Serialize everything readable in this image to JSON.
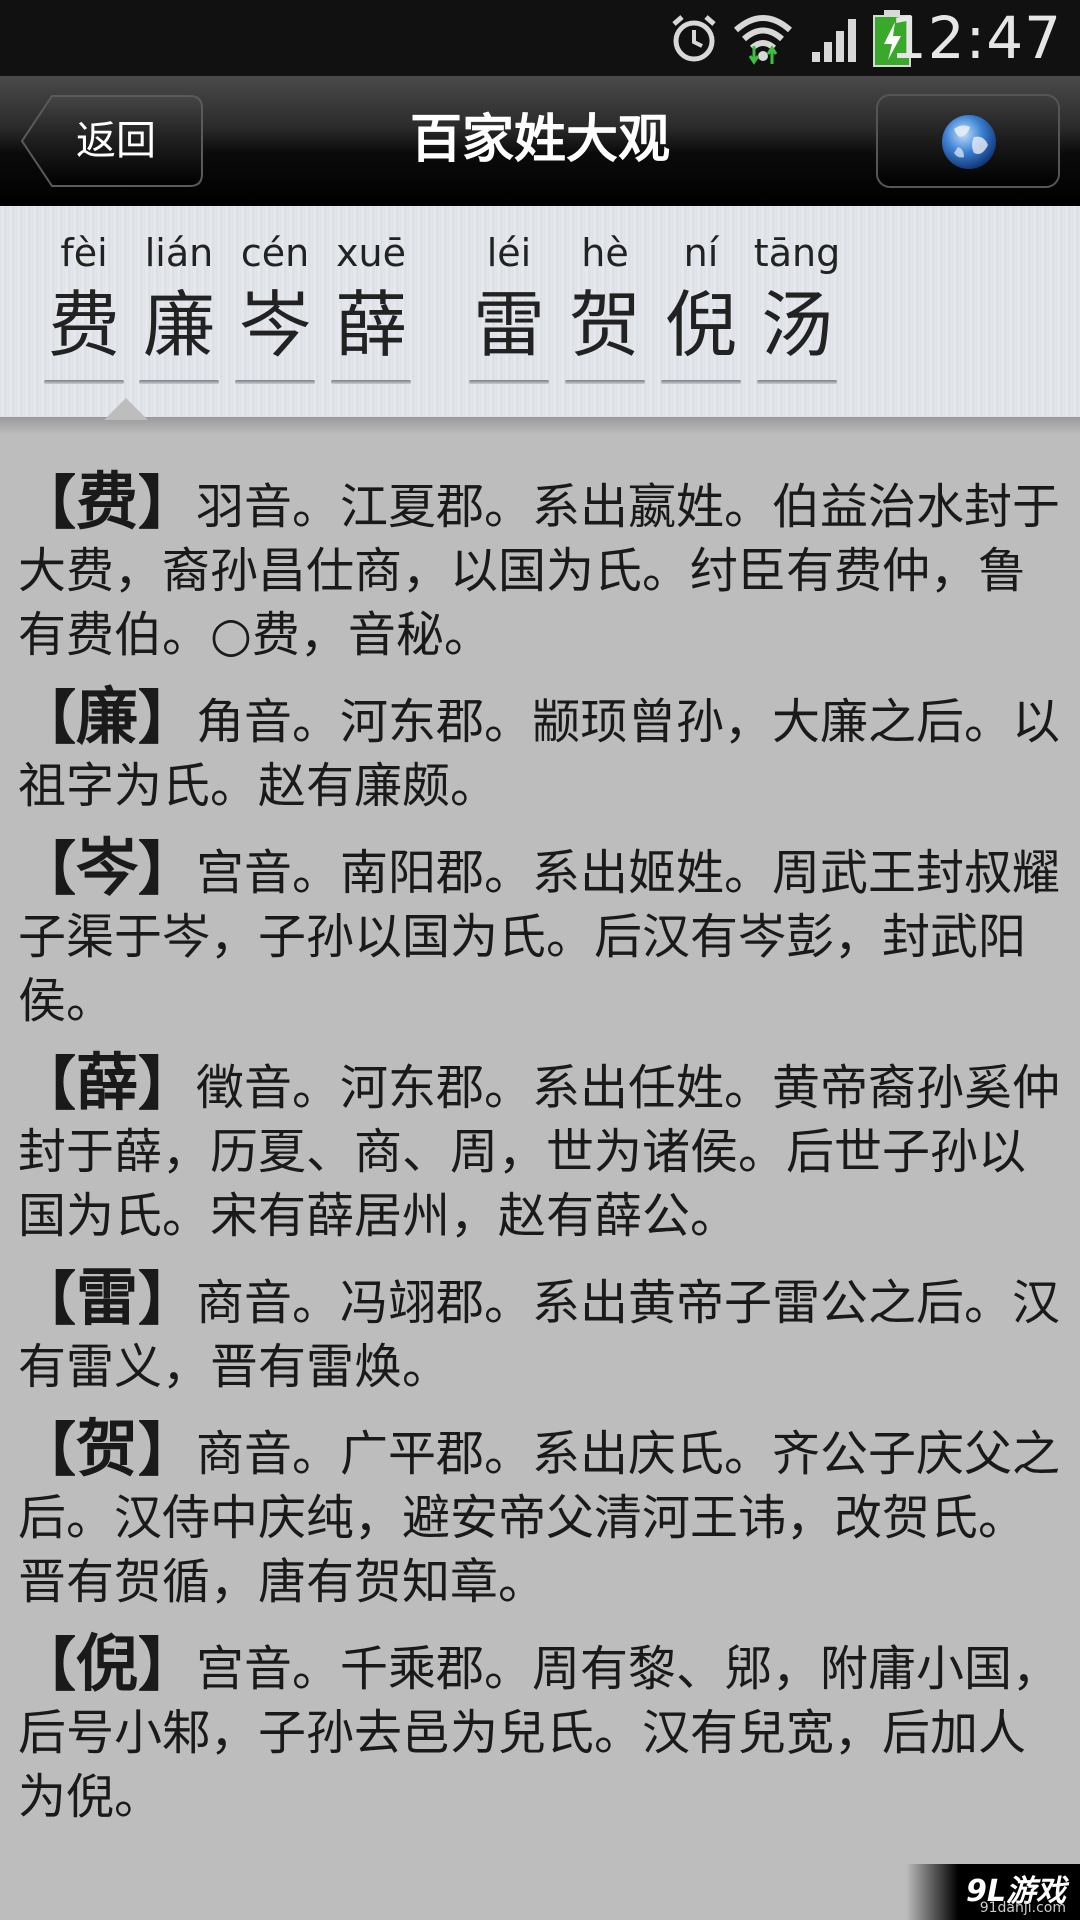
{
  "status_bar": {
    "time": "12:47",
    "icons": [
      "alarm-icon",
      "wifi-icon",
      "signal-icon",
      "battery-charging-icon"
    ]
  },
  "title_bar": {
    "back_label": "返回",
    "title": "百家姓大观",
    "globe_icon": "globe-icon"
  },
  "header": {
    "chars": [
      {
        "pinyin": "fèi",
        "char": "费"
      },
      {
        "pinyin": "lián",
        "char": "廉"
      },
      {
        "pinyin": "cén",
        "char": "岑"
      },
      {
        "pinyin": "xuē",
        "char": "薛"
      },
      {
        "pinyin": "léi",
        "char": "雷"
      },
      {
        "pinyin": "hè",
        "char": "贺"
      },
      {
        "pinyin": "ní",
        "char": "倪"
      },
      {
        "pinyin": "tāng",
        "char": "汤"
      }
    ]
  },
  "entries": [
    {
      "open": "【",
      "char": "费",
      "close": "】",
      "text": "羽音。江夏郡。系出嬴姓。伯益治水封于大费，裔孙昌仕商，以国为氏。纣臣有费仲，鲁有费伯。○费，音秘。"
    },
    {
      "open": "【",
      "char": "廉",
      "close": "】",
      "text": "角音。河东郡。颛顼曾孙，大廉之后。以祖字为氏。赵有廉颇。"
    },
    {
      "open": "【",
      "char": "岑",
      "close": "】",
      "text": "宫音。南阳郡。系出姬姓。周武王封叔耀子渠于岑，子孙以国为氏。后汉有岑彭，封武阳侯。"
    },
    {
      "open": "【",
      "char": "薛",
      "close": "】",
      "text": "徵音。河东郡。系出任姓。黄帝裔孙奚仲封于薛，历夏、商、周，世为诸侯。后世子孙以国为氏。宋有薛居州，赵有薛公。"
    },
    {
      "open": "【",
      "char": "雷",
      "close": "】",
      "text": "商音。冯翊郡。系出黄帝子雷公之后。汉有雷义，晋有雷焕。"
    },
    {
      "open": "【",
      "char": "贺",
      "close": "】",
      "text": "商音。广平郡。系出庆氏。齐公子庆父之后。汉侍中庆纯，避安帝父清河王讳，改贺氏。晋有贺循，唐有贺知章。"
    },
    {
      "open": "【",
      "char": "倪",
      "close": "】",
      "text": "宫音。千乘郡。周有黎、郳，附庸小国，后号小邾，子孙去邑为兒氏。汉有兒宽，后加人为倪。"
    }
  ],
  "watermark": {
    "logo": "9L游戏",
    "url": "91danji.com"
  }
}
